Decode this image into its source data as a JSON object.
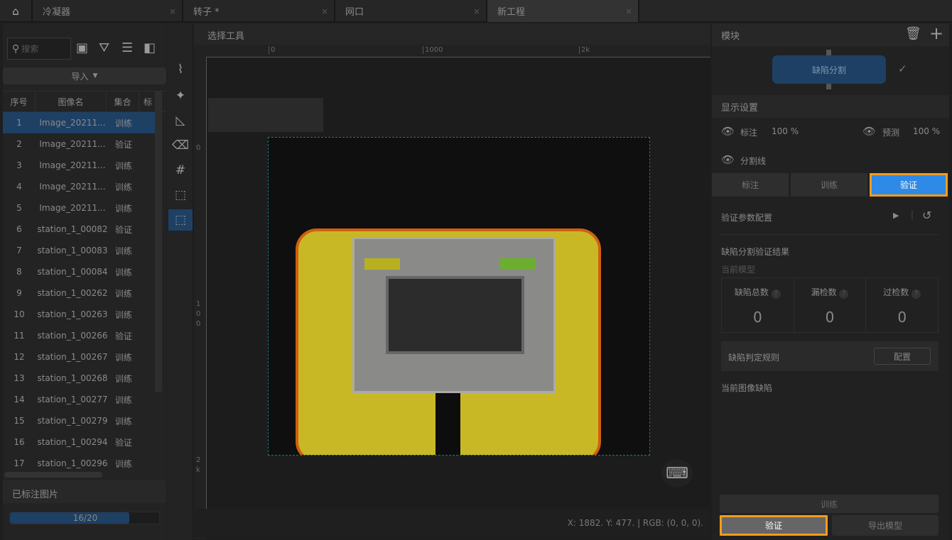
{
  "tabs": [
    {
      "label": "冷凝器"
    },
    {
      "label": "转子 *"
    },
    {
      "label": "网口"
    },
    {
      "label": "新工程"
    }
  ],
  "left": {
    "search_placeholder": "搜索",
    "import_label": "导入",
    "columns": [
      "序号",
      "图像名",
      "集合",
      "标"
    ],
    "rows": [
      {
        "index": "1",
        "name": "Image_20211...",
        "set": "训练"
      },
      {
        "index": "2",
        "name": "Image_20211...",
        "set": "验证"
      },
      {
        "index": "3",
        "name": "Image_20211...",
        "set": "训练"
      },
      {
        "index": "4",
        "name": "Image_20211...",
        "set": "训练"
      },
      {
        "index": "5",
        "name": "Image_20211...",
        "set": "训练"
      },
      {
        "index": "6",
        "name": "station_1_00082",
        "set": "验证"
      },
      {
        "index": "7",
        "name": "station_1_00083",
        "set": "训练"
      },
      {
        "index": "8",
        "name": "station_1_00084",
        "set": "训练"
      },
      {
        "index": "9",
        "name": "station_1_00262",
        "set": "训练"
      },
      {
        "index": "10",
        "name": "station_1_00263",
        "set": "训练"
      },
      {
        "index": "11",
        "name": "station_1_00266",
        "set": "验证"
      },
      {
        "index": "12",
        "name": "station_1_00267",
        "set": "训练"
      },
      {
        "index": "13",
        "name": "station_1_00268",
        "set": "训练"
      },
      {
        "index": "14",
        "name": "station_1_00277",
        "set": "训练"
      },
      {
        "index": "15",
        "name": "station_1_00279",
        "set": "训练"
      },
      {
        "index": "16",
        "name": "station_1_00294",
        "set": "验证"
      },
      {
        "index": "17",
        "name": "station_1_00296",
        "set": "训练"
      }
    ],
    "labeled_title": "已标注图片",
    "progress_text": "16/20",
    "progress": 0.8
  },
  "canvas": {
    "title": "选择工具",
    "ruler_top": [
      "0",
      "1000",
      "2k"
    ],
    "ruler_left": [
      "0",
      "1\n0\n0",
      "2\nk"
    ],
    "status": "X: 1882. Y: 477. | RGB: (0, 0, 0)."
  },
  "right": {
    "module_title": "模块",
    "module_node": "缺陷分割",
    "display_title": "显示设置",
    "annot_label": "标注",
    "annot_pct": "100 %",
    "pred_label": "预测",
    "pred_pct": "100 %",
    "seg_line_label": "分割线",
    "modes": [
      "标注",
      "训练",
      "验证"
    ],
    "active_mode": "验证",
    "param_config": "验证参数配置",
    "result_title": "缺陷分割验证结果",
    "current_model": "当前模型",
    "stats": [
      {
        "label": "缺陷总数",
        "value": "0"
      },
      {
        "label": "漏检数",
        "value": "0"
      },
      {
        "label": "过检数",
        "value": "0"
      }
    ],
    "rule_label": "缺陷判定规则",
    "config_btn": "配置",
    "current_defects": "当前图像缺陷",
    "train_btn": "训练",
    "validate_btn": "验证",
    "export_btn": "导出模型"
  },
  "colors": {
    "accent": "#2e8ae6",
    "highlight": "#f39c1f",
    "selected_row": "#1e4064"
  }
}
